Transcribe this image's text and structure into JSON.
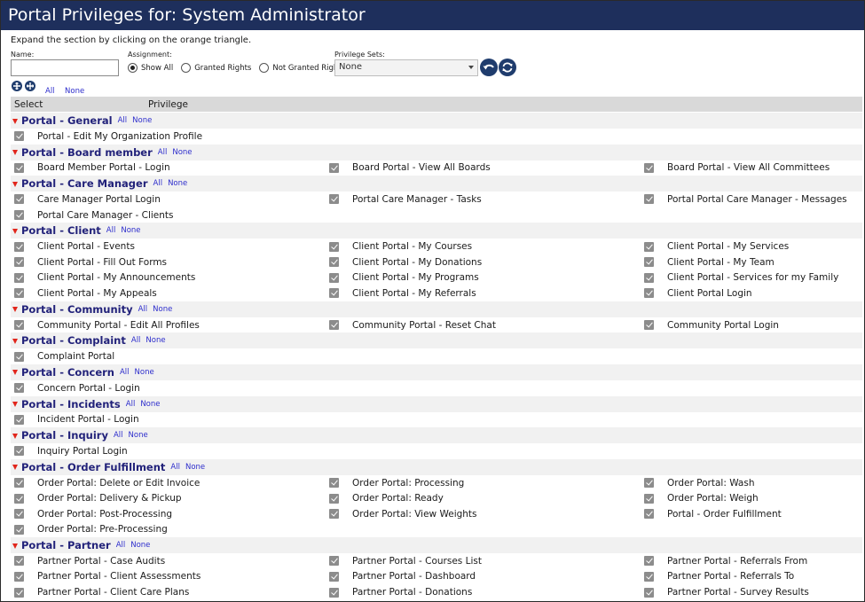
{
  "title": "Portal Privileges for: System Administrator",
  "instructions": "Expand the section by clicking on the orange triangle.",
  "filters": {
    "name_label": "Name:",
    "name_value": "",
    "assignment_label": "Assignment:",
    "assignment_options": [
      "Show All",
      "Granted Rights",
      "Not Granted Rights"
    ],
    "assignment_selected": "Show All",
    "privilege_sets_label": "Privilege Sets:",
    "privilege_sets_value": "None"
  },
  "links": {
    "all": "All",
    "none": "None"
  },
  "columns": {
    "select": "Select",
    "privilege": "Privilege"
  },
  "icons": {
    "undo": "undo-icon",
    "refresh": "refresh-icon",
    "expand_all": "expand-all-icon",
    "collapse_all": "collapse-all-icon"
  },
  "sections": [
    {
      "title": "Portal - General",
      "items": [
        "Portal - Edit My Organization Profile"
      ]
    },
    {
      "title": "Portal - Board member",
      "items": [
        "Board Member Portal - Login",
        "Board Portal - View All Boards",
        "Board Portal - View All Committees"
      ]
    },
    {
      "title": "Portal - Care Manager",
      "items": [
        "Care Manager Portal Login",
        "Portal Care Manager - Tasks",
        "Portal Portal Care Manager - Messages",
        "Portal Care Manager - Clients"
      ]
    },
    {
      "title": "Portal - Client",
      "items": [
        "Client Portal - Events",
        "Client Portal - My Courses",
        "Client Portal - My Services",
        "Client Portal - Fill Out Forms",
        "Client Portal - My Donations",
        "Client Portal - My Team",
        "Client Portal - My Announcements",
        "Client Portal - My Programs",
        "Client Portal - Services for my Family",
        "Client Portal - My Appeals",
        "Client Portal - My Referrals",
        "Client Portal Login"
      ]
    },
    {
      "title": "Portal - Community",
      "items": [
        "Community Portal - Edit All Profiles",
        "Community Portal - Reset Chat",
        "Community Portal Login"
      ]
    },
    {
      "title": "Portal - Complaint",
      "items": [
        "Complaint Portal"
      ]
    },
    {
      "title": "Portal - Concern",
      "items": [
        "Concern Portal - Login"
      ]
    },
    {
      "title": "Portal - Incidents",
      "items": [
        "Incident Portal - Login"
      ]
    },
    {
      "title": "Portal - Inquiry",
      "items": [
        "Inquiry Portal Login"
      ]
    },
    {
      "title": "Portal - Order Fulfillment",
      "items": [
        "Order Portal: Delete or Edit Invoice",
        "Order Portal: Processing",
        "Order Portal: Wash",
        "Order Portal: Delivery & Pickup",
        "Order Portal: Ready",
        "Order Portal: Weigh",
        "Order Portal: Post-Processing",
        "Order Portal: View Weights",
        "Portal - Order Fulfillment",
        "Order Portal: Pre-Processing"
      ]
    },
    {
      "title": "Portal - Partner",
      "items": [
        "Partner Portal - Case Audits",
        "Partner Portal - Courses List",
        "Partner Portal - Referrals From",
        "Partner Portal - Client Assessments",
        "Partner Portal - Dashboard",
        "Partner Portal - Referrals To",
        "Partner Portal - Client Care Plans",
        "Partner Portal - Donations",
        "Partner Portal - Survey Results"
      ]
    }
  ]
}
